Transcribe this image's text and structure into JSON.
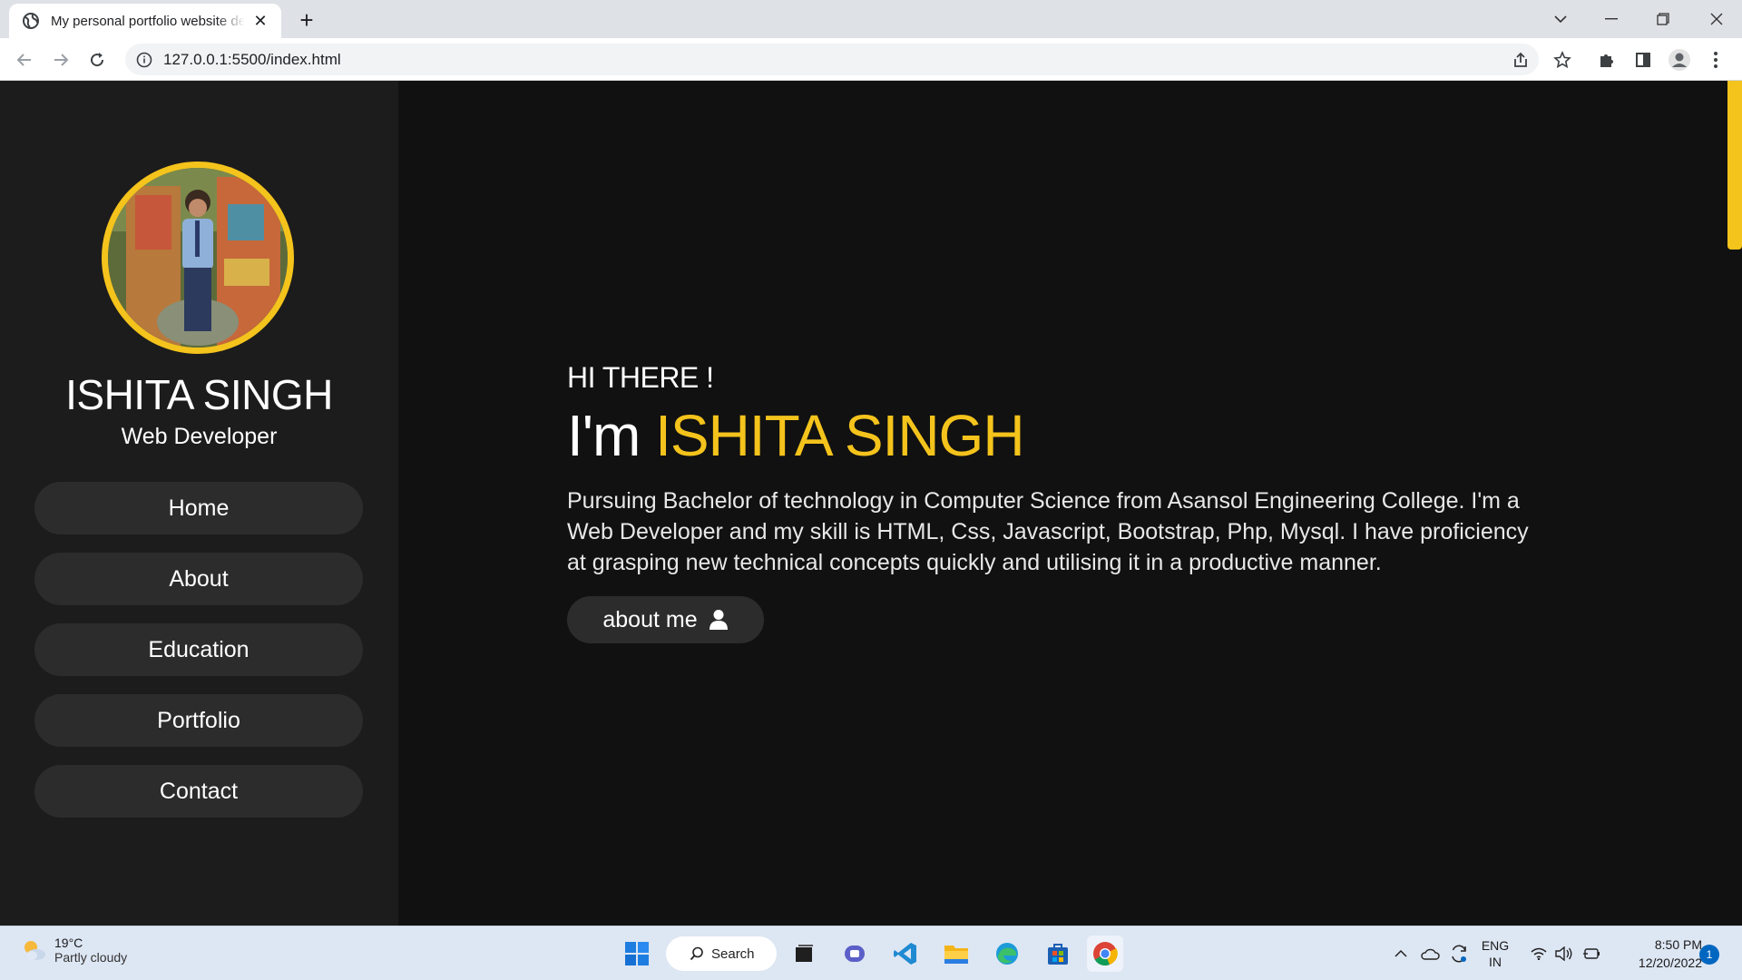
{
  "browser": {
    "tab_title": "My personal portfolio website design",
    "url": "127.0.0.1:5500/index.html"
  },
  "sidebar": {
    "name": "ISHITA SINGH",
    "role": "Web Developer",
    "menu": [
      {
        "label": "Home"
      },
      {
        "label": "About"
      },
      {
        "label": "Education"
      },
      {
        "label": "Portfolio"
      },
      {
        "label": "Contact"
      }
    ]
  },
  "hero": {
    "greeting": "HI THERE !",
    "headline_prefix": "I'm ",
    "headline_name": "ISHITA SINGH",
    "bio": "Pursuing Bachelor of technology in Computer Science from Asansol Engineering College. I'm a Web Developer and my skill is HTML, Css, Javascript, Bootstrap, Php, Mysql. I have proficiency at grasping new technical concepts quickly and utilising it in a productive manner.",
    "cta_label": "about me",
    "cta_icon": "user-icon"
  },
  "colors": {
    "accent": "#f4c31c",
    "background": "#111111",
    "sidebar": "#1c1c1c",
    "button": "#2c2c2c"
  },
  "taskbar": {
    "weather_temp": "19°C",
    "weather_condition": "Partly cloudy",
    "search_label": "Search",
    "lang_line1": "ENG",
    "lang_line2": "IN",
    "time": "8:50 PM",
    "date": "12/20/2022",
    "notification_count": "1"
  }
}
